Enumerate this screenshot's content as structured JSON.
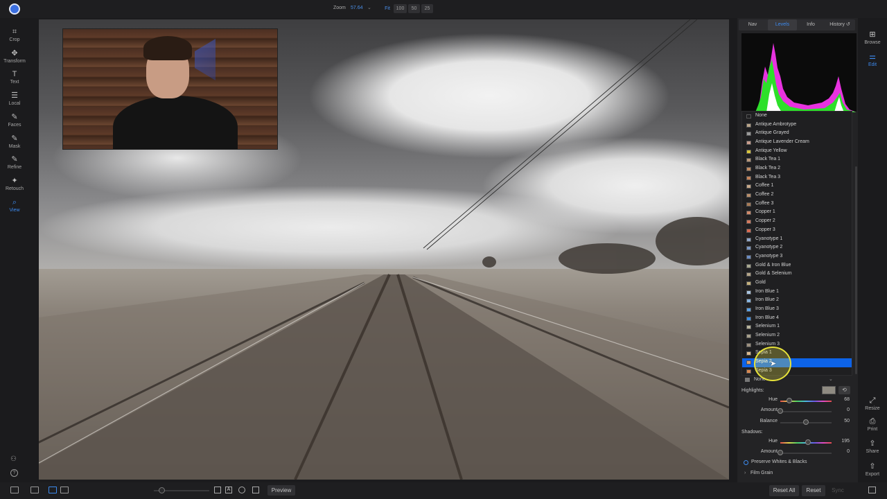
{
  "topbar": {
    "zoom_label": "Zoom",
    "zoom_value": "57.64",
    "zoom_presets": [
      "Fit",
      "100",
      "50",
      "25"
    ]
  },
  "left_tools": [
    {
      "label": "Crop",
      "icon": "crop-icon",
      "glyph": "⌗"
    },
    {
      "label": "Transform",
      "icon": "transform-icon",
      "glyph": "✥"
    },
    {
      "label": "Text",
      "icon": "text-icon",
      "glyph": "T"
    },
    {
      "label": "Local",
      "icon": "local-icon",
      "glyph": "☰"
    },
    {
      "label": "Faces",
      "icon": "faces-icon",
      "glyph": "✎"
    },
    {
      "label": "Mask",
      "icon": "mask-icon",
      "glyph": "✎"
    },
    {
      "label": "Refine",
      "icon": "refine-icon",
      "glyph": "✎"
    },
    {
      "label": "Retouch",
      "icon": "retouch-icon",
      "glyph": "✦"
    },
    {
      "label": "View",
      "icon": "view-icon",
      "glyph": "⌕",
      "active": true
    }
  ],
  "right_panel": {
    "tabs": [
      {
        "label": "Nav"
      },
      {
        "label": "Levels",
        "active": true
      },
      {
        "label": "Info"
      },
      {
        "label": "History ↺"
      }
    ],
    "presets": [
      {
        "label": "None",
        "color": "#1f1f21"
      },
      {
        "label": "Antique Ambrotype",
        "color": "#b9a58a"
      },
      {
        "label": "Antique Grayed",
        "color": "#9a9a9a"
      },
      {
        "label": "Antique Lavender Cream",
        "color": "#c89c8c"
      },
      {
        "label": "Antique Yellow",
        "color": "#d8c43a"
      },
      {
        "label": "Black Tea 1",
        "color": "#b8977a"
      },
      {
        "label": "Black Tea 2",
        "color": "#c08b62"
      },
      {
        "label": "Black Tea 3",
        "color": "#c4835a"
      },
      {
        "label": "Coffee 1",
        "color": "#c7a889"
      },
      {
        "label": "Coffee 2",
        "color": "#b88e6a"
      },
      {
        "label": "Coffee 3",
        "color": "#a77a56"
      },
      {
        "label": "Copper 1",
        "color": "#d08a6a"
      },
      {
        "label": "Copper 2",
        "color": "#d67a5e"
      },
      {
        "label": "Copper 3",
        "color": "#d86a52"
      },
      {
        "label": "Cyanotype 1",
        "color": "#8fa6c8"
      },
      {
        "label": "Cyanotype 2",
        "color": "#7b98c4"
      },
      {
        "label": "Cyanotype 3",
        "color": "#6a8cc4"
      },
      {
        "label": "Gold & Iron Blue",
        "color": "#a8a890"
      },
      {
        "label": "Gold & Selenium",
        "color": "#b4a488"
      },
      {
        "label": "Gold",
        "color": "#c4b07c"
      },
      {
        "label": "Iron Blue 1",
        "color": "#a9c4e0"
      },
      {
        "label": "Iron Blue 2",
        "color": "#88b4e0"
      },
      {
        "label": "Iron Blue 3",
        "color": "#5aa0e4"
      },
      {
        "label": "Iron Blue 4",
        "color": "#3a8ce4"
      },
      {
        "label": "Selenium 1",
        "color": "#b8b49c"
      },
      {
        "label": "Selenium 2",
        "color": "#a8a08c"
      },
      {
        "label": "Selenium 3",
        "color": "#9c9080"
      },
      {
        "label": "Sepia 1",
        "color": "#d8b890"
      },
      {
        "label": "Sepia 2",
        "color": "#d8a070",
        "selected": true
      },
      {
        "label": "Sepia 3",
        "color": "#d88850"
      }
    ],
    "selected_value": "None",
    "highlights": {
      "label": "Highlights:",
      "swatch_color": "#8f8b82",
      "sliders": [
        {
          "name": "Hue",
          "value": "68",
          "fraction": 0.18,
          "hue": true
        },
        {
          "name": "Amount",
          "value": "0",
          "fraction": 0.0
        },
        {
          "name": "Balance",
          "value": "50",
          "fraction": 0.5
        }
      ]
    },
    "shadows": {
      "label": "Shadows:",
      "sliders": [
        {
          "name": "Hue",
          "value": "195",
          "fraction": 0.54,
          "hue": true
        },
        {
          "name": "Amount",
          "value": "0",
          "fraction": 0.0
        }
      ]
    },
    "preserve_label": "Preserve Whites & Blacks",
    "film_grain_label": "Film Grain"
  },
  "module_bar": [
    {
      "label": "Browse",
      "icon": "browse-icon",
      "glyph": "⊞"
    },
    {
      "label": "Edit",
      "icon": "edit-icon",
      "glyph": "⚌",
      "active": true
    },
    {
      "label": "Resize",
      "icon": "resize-icon",
      "glyph": "⤢"
    },
    {
      "label": "Print",
      "icon": "print-icon",
      "glyph": "⎙"
    },
    {
      "label": "Share",
      "icon": "share-icon",
      "glyph": "⇪"
    },
    {
      "label": "Export",
      "icon": "export-icon",
      "glyph": "⇧"
    }
  ],
  "bottombar": {
    "preview_label": "Preview",
    "reset_all_label": "Reset All",
    "reset_label": "Reset",
    "sync_label": "Sync"
  },
  "colors": {
    "accent": "#3d8bf0",
    "selection": "#0d63e8",
    "histogram_green": "#2de02a",
    "histogram_magenta": "#e832e0"
  }
}
